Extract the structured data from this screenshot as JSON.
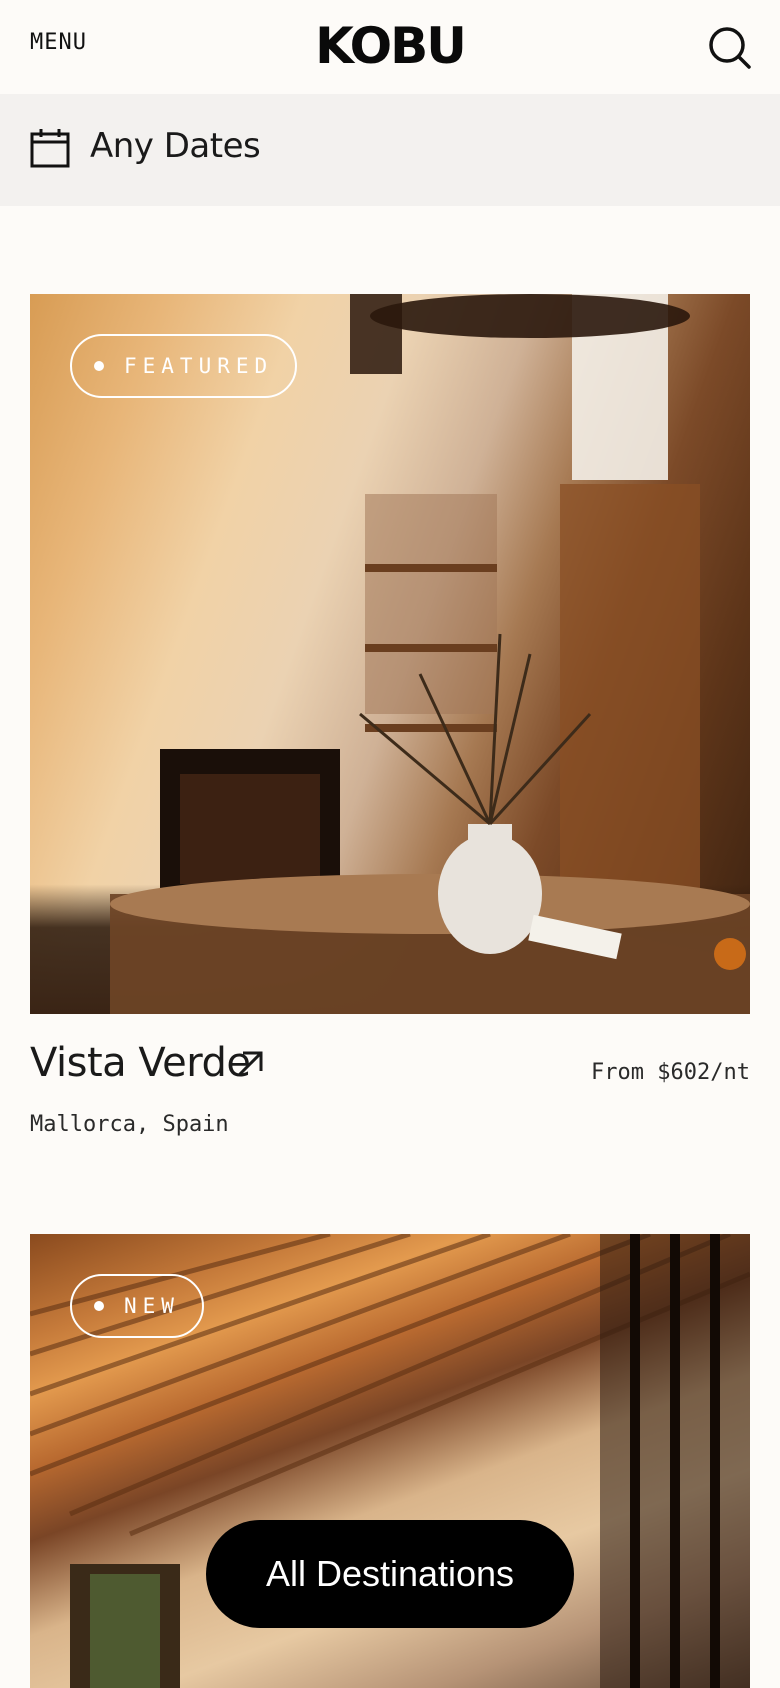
{
  "header": {
    "menu_label": "MENU",
    "logo": "KOBU",
    "search_icon": "search-icon"
  },
  "datebar": {
    "icon": "calendar-icon",
    "label": "Any Dates"
  },
  "listings": [
    {
      "badge": "FEATURED",
      "name": "Vista Verde",
      "link_icon": "arrow-up-right-icon",
      "price": "From $602/nt",
      "location": "Mallorca, Spain"
    },
    {
      "badge": "NEW"
    }
  ],
  "cta": {
    "label": "All Destinations"
  },
  "colors": {
    "background": "#fdfbf8",
    "datebar_bg": "#f3f1ef",
    "text": "#1a1a1a",
    "cta_bg": "#000000",
    "cta_text": "#ffffff"
  }
}
